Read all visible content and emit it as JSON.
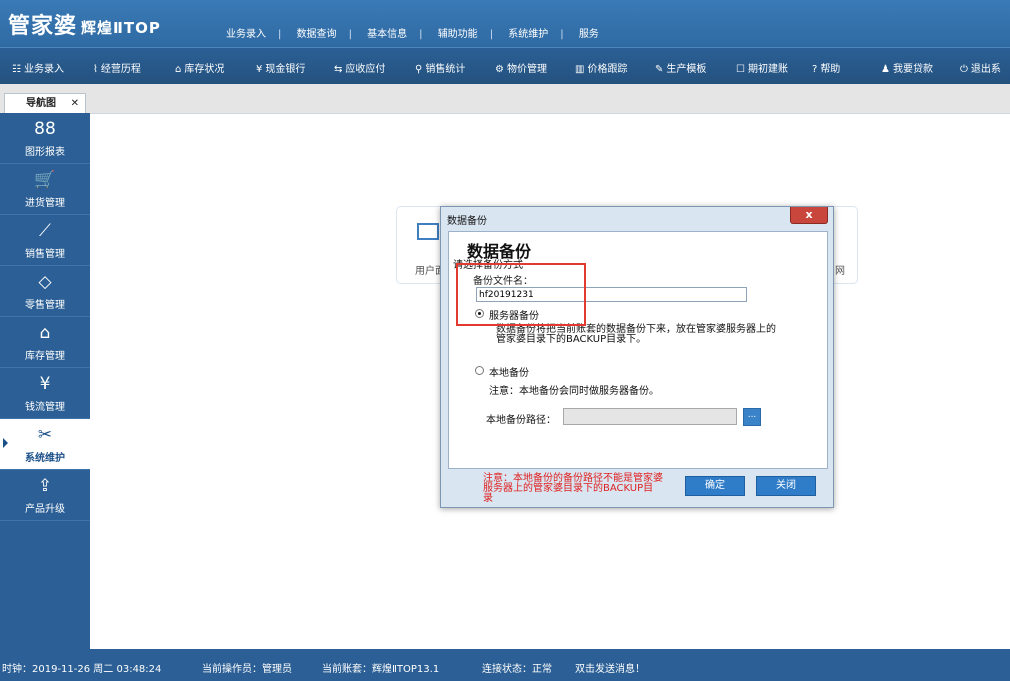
{
  "app": {
    "logo_main": "管家婆",
    "logo_sub": "辉煌ⅡTOP",
    "top_menu": [
      "业务录入",
      "数据查询",
      "基本信息",
      "辅助功能",
      "系统维护",
      "服务"
    ]
  },
  "toolbar": {
    "items": [
      {
        "icon": "☷",
        "label": "业务录入"
      },
      {
        "icon": "⌇",
        "label": "经营历程"
      },
      {
        "icon": "⌂",
        "label": "库存状况"
      },
      {
        "icon": "¥",
        "label": "现金银行"
      },
      {
        "icon": "⇆",
        "label": "应收应付"
      },
      {
        "icon": "⚲",
        "label": "销售统计"
      },
      {
        "icon": "⚙",
        "label": "物价管理"
      },
      {
        "icon": "▥",
        "label": "价格跟踪"
      },
      {
        "icon": "✎",
        "label": "生产模板"
      },
      {
        "icon": "☐",
        "label": "期初建账"
      },
      {
        "icon": "?",
        "label": "帮助"
      },
      {
        "icon": "♟",
        "label": "我要贷款"
      },
      {
        "icon": "⏻",
        "label": "退出系"
      }
    ]
  },
  "tabs": [
    {
      "label": "导航图",
      "close": "✕"
    }
  ],
  "sidebar": {
    "items": [
      {
        "icon": "88",
        "label": "图形报表"
      },
      {
        "icon": "🛒",
        "label": "进货管理"
      },
      {
        "icon": "⟋",
        "label": "销售管理"
      },
      {
        "icon": "◇",
        "label": "零售管理"
      },
      {
        "icon": "⌂",
        "label": "库存管理"
      },
      {
        "icon": "¥",
        "label": "钱流管理"
      },
      {
        "icon": "✂",
        "label": "系统维护"
      },
      {
        "icon": "⇪",
        "label": "产品升级"
      }
    ],
    "active_index": 6
  },
  "background_card": {
    "left_label": "用户面",
    "right_label": "网"
  },
  "dialog": {
    "title": "数据备份",
    "close": "x",
    "heading": "数据备份",
    "subheading": "请选择备份方式",
    "filename_label": "备份文件名：",
    "filename_value": "hf20191231",
    "server_option": "服务器备份",
    "server_desc": "数据备份将把当前账套的数据备份下来，放在管家婆服务器上的管家婆目录下的BACKUP目录下。",
    "local_option": "本地备份",
    "local_note": "注意：本地备份会同时做服务器备份。",
    "local_path_label": "本地备份路径：",
    "local_path_value": "",
    "browse_label": "...",
    "footer_note": "注意：本地备份的备份路径不能是管家婆服务器上的管家婆目录下的BACKUP目录",
    "ok": "确定",
    "close_btn": "关闭",
    "selected_option": "server"
  },
  "status": {
    "time": "时钟：2019-11-26 周二 03:48:24",
    "operator": "当前操作员：管理员",
    "account": "当前账套：辉煌ⅡTOP13.1",
    "connection": "连接状态：正常",
    "message": "双击发送消息！"
  }
}
